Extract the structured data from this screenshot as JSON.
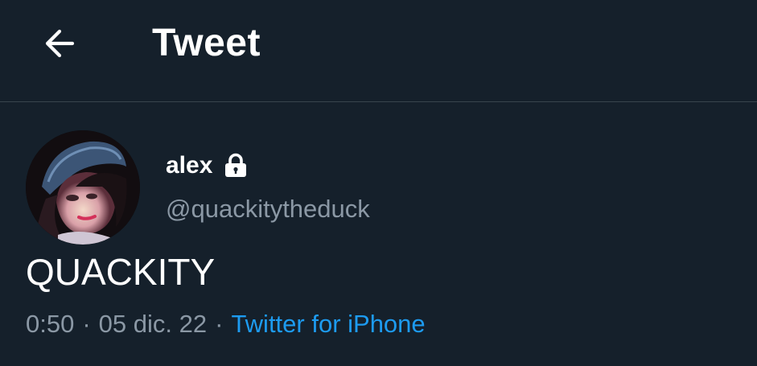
{
  "header": {
    "back_icon": "arrow-left-icon",
    "title": "Tweet"
  },
  "tweet": {
    "author": {
      "display_name": "alex",
      "protected_icon": "lock-icon",
      "handle": "@quackitytheduck",
      "avatar_icon": "profile-photo"
    },
    "text": "QUACKITY",
    "time": "0:50",
    "separator": "·",
    "date": "05 dic. 22",
    "source": "Twitter for iPhone"
  },
  "colors": {
    "background": "#15202b",
    "divider": "#38444d",
    "primary_text": "#ffffff",
    "secondary_text": "#8b98a5",
    "accent": "#1d9bf0"
  }
}
